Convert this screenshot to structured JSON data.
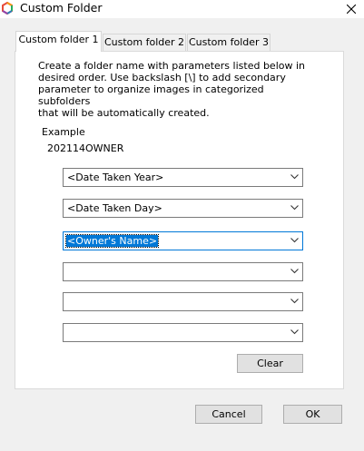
{
  "window": {
    "title": "Custom Folder",
    "app_icon": "app-logo-icon",
    "close_icon": "close-icon"
  },
  "tabs": [
    {
      "label": "Custom folder 1",
      "active": true
    },
    {
      "label": "Custom folder 2",
      "active": false
    },
    {
      "label": "Custom folder 3",
      "active": false
    }
  ],
  "description": "Create a folder name with parameters listed below in\ndesired order. Use backslash [\\] to add secondary\nparameter to organize images in categorized subfolders\nthat will be automatically created.",
  "example": {
    "label": "Example",
    "value": "202114OWNER"
  },
  "dropdowns": [
    {
      "value": "<Date Taken Year>",
      "selected": false
    },
    {
      "value": "<Date Taken Day>",
      "selected": false
    },
    {
      "value": "<Owner's Name>",
      "selected": true
    },
    {
      "value": "",
      "selected": false
    },
    {
      "value": "",
      "selected": false
    },
    {
      "value": "",
      "selected": false
    }
  ],
  "buttons": {
    "clear": "Clear",
    "cancel": "Cancel",
    "ok": "OK"
  },
  "colors": {
    "accent": "#0078d7",
    "window_bg": "#f0f0f0",
    "panel_bg": "#ffffff",
    "button_bg": "#e1e1e1"
  }
}
